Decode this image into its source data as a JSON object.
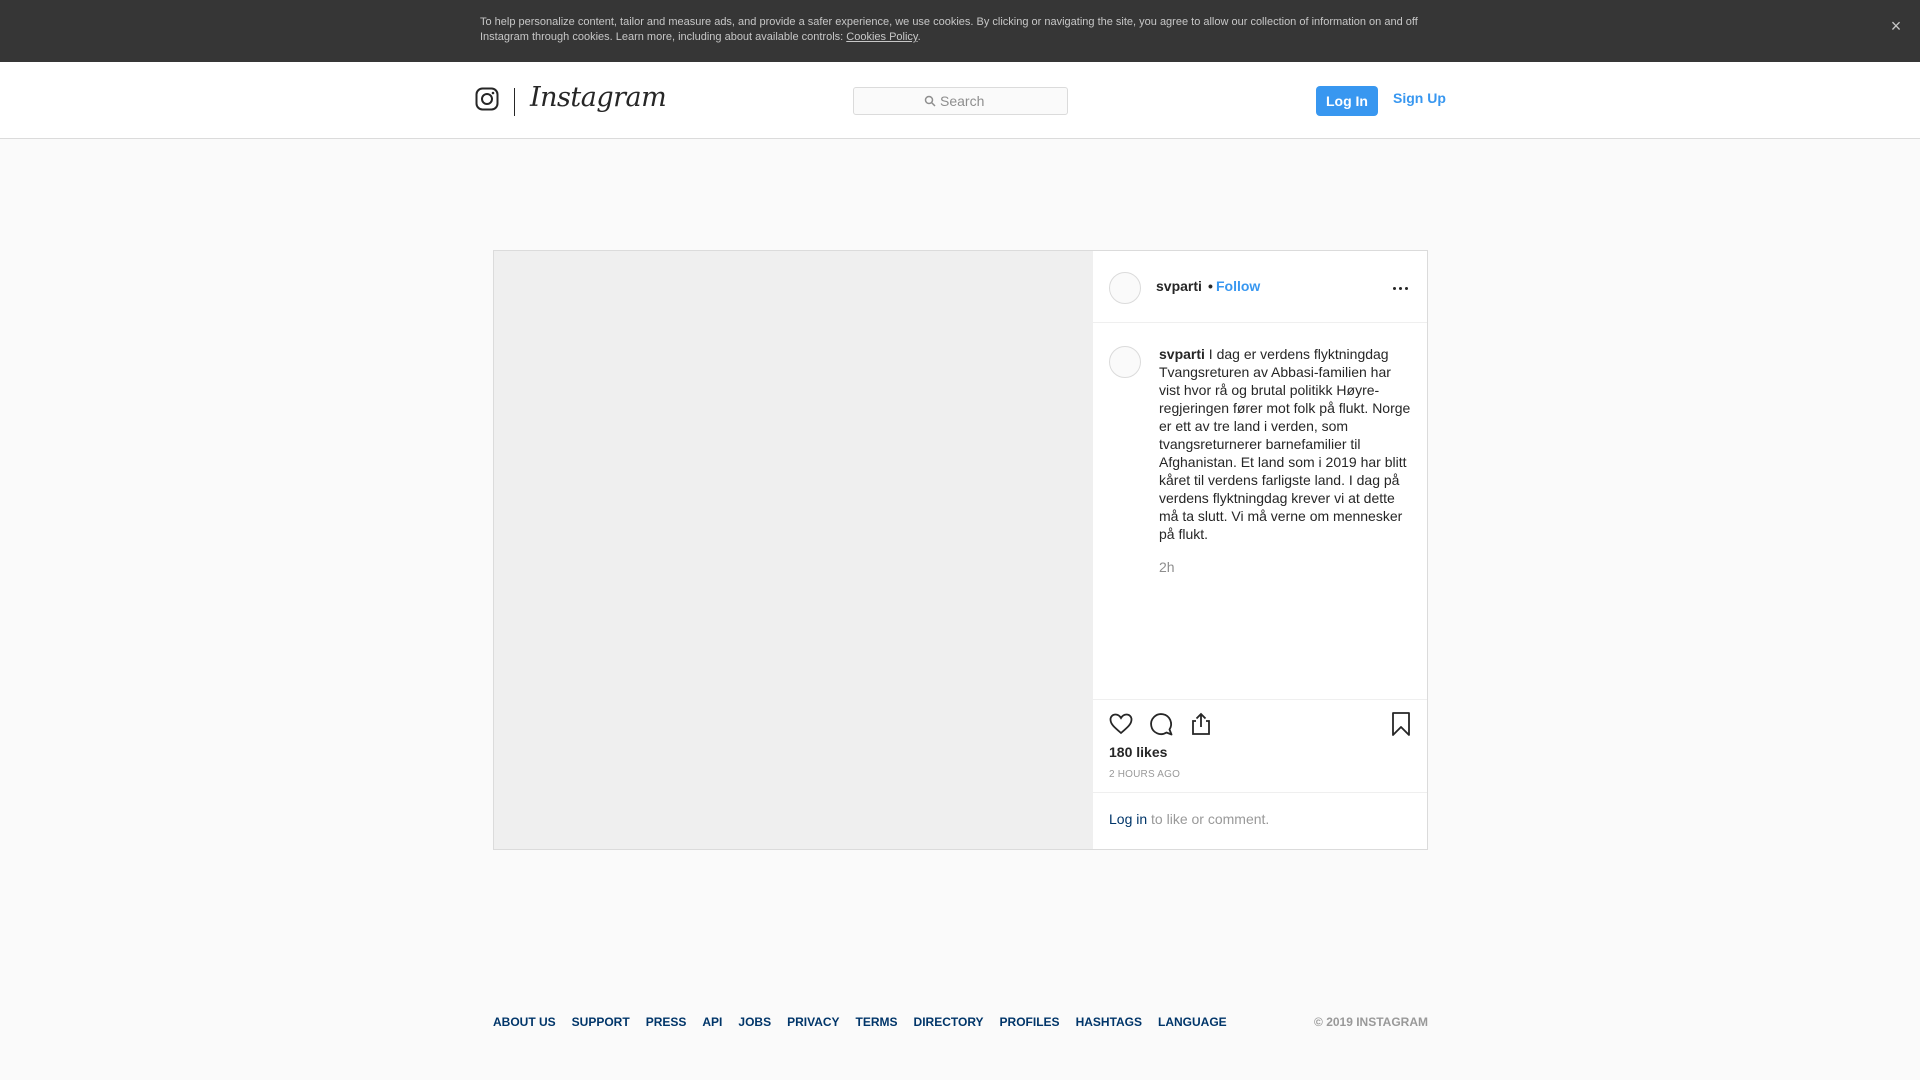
{
  "cookie_banner": {
    "text": "To help personalize content, tailor and measure ads, and provide a safer experience, we use cookies. By clicking or navigating the site, you agree to allow our collection of information on and off Instagram through cookies. Learn more, including about available controls: ",
    "link_label": "Cookies Policy",
    "trailing": ".",
    "close_glyph": "×"
  },
  "nav": {
    "logo_icon": "instagram-glyph-icon",
    "wordmark": "Instagram",
    "search_placeholder": "Search",
    "login_label": "Log In",
    "signup_label": "Sign Up"
  },
  "post": {
    "username": "svparti",
    "separator": " •",
    "follow_label": "Follow",
    "caption_text": " I dag er verdens flyktningdag Tvangsreturen av Abbasi-familien har vist hvor rå og brutal politikk Høyre-regjeringen fører mot folk på flukt. Norge er ett av tre land i verden, som tvangsreturnerer barnefamilier til Afghanistan. Et land som i 2019 har blitt kåret til verdens farligste land. I dag på verdens flyktningdag krever vi at dette må ta slutt. Vi må verne om mennesker på flukt.",
    "caption_time": "2h",
    "likes": "180 likes",
    "time_ago": "2 HOURS AGO",
    "login_link": "Log in",
    "login_rest": " to like or comment."
  },
  "footer": {
    "links": [
      "ABOUT US",
      "SUPPORT",
      "PRESS",
      "API",
      "JOBS",
      "PRIVACY",
      "TERMS",
      "DIRECTORY",
      "PROFILES",
      "HASHTAGS",
      "LANGUAGE"
    ],
    "copyright": "© 2019 INSTAGRAM"
  },
  "colors": {
    "accent": "#3897f0",
    "link_dark": "#003569",
    "banner_bg": "#363636"
  }
}
